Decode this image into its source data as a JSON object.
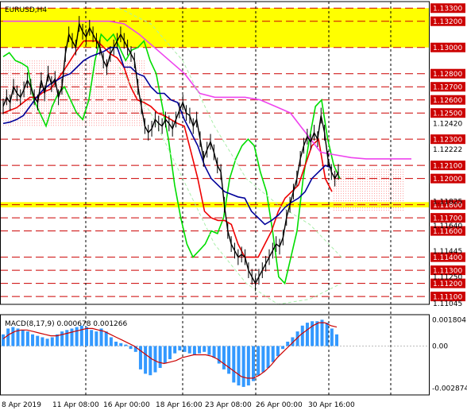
{
  "header": {
    "symbol_label": "EURUSD,H4",
    "macd_label": "MACD(8,17,9) 0.000678 0.001266"
  },
  "colors": {
    "background": "#ffffff",
    "grid": "#000000",
    "level_line": "#cc0000",
    "level_label_bg": "#cc0000",
    "level_label_text": "#ffffff",
    "yellow_zone": "#ffff00",
    "price_series": "#000000",
    "green_line": "#00dd00",
    "red_line": "#ee0000",
    "navy_line": "#000099",
    "magenta_line": "#ee44ee",
    "cloud_dots": "#ff9999",
    "envelope": "#aaeeaa",
    "macd_histogram": "#3399ff",
    "macd_signal": "#cc0000"
  },
  "chart_data": [
    {
      "type": "line",
      "title": "EURUSD,H4",
      "x_tick_labels": [
        "8 Apr 2019",
        "11 Apr 08:00",
        "16 Apr 00:00",
        "18 Apr 16:00",
        "23 Apr 08:00",
        "26 Apr 00:00",
        "30 Apr 16:00"
      ],
      "ylim": [
        1.1104,
        1.1335
      ],
      "grid": true,
      "yellow_zones": [
        [
          1.13,
          1.133
        ],
        [
          1.1178,
          1.1182
        ]
      ],
      "levels": [
        1.133,
        1.132,
        1.13,
        1.128,
        1.127,
        1.126,
        1.125,
        1.123,
        1.121,
        1.12,
        1.118,
        1.117,
        1.116,
        1.114,
        1.113,
        1.112,
        1.111
      ],
      "level_labels": [
        "1.13300",
        "1.13200",
        "1.13000",
        "1.12800",
        "1.12700",
        "1.12600",
        "1.12500",
        "1.12300",
        "1.12100",
        "1.12000",
        "1.11800",
        "1.11700",
        "1.11600",
        "1.11400",
        "1.11300",
        "1.11200",
        "1.11100"
      ],
      "scale_ticks": [
        "1.12420",
        "1.12222",
        "1.11825",
        "1.11640",
        "1.11445",
        "1.11250",
        "1.11045"
      ],
      "price": [
        1.1255,
        1.1262,
        1.1258,
        1.127,
        1.1265,
        1.1262,
        1.1268,
        1.1275,
        1.127,
        1.1262,
        1.1258,
        1.1275,
        1.1265,
        1.128,
        1.1272,
        1.1276,
        1.1262,
        1.127,
        1.1295,
        1.131,
        1.1305,
        1.13,
        1.1318,
        1.1312,
        1.1308,
        1.1315,
        1.131,
        1.1305,
        1.13,
        1.129,
        1.1285,
        1.1295,
        1.13,
        1.1305,
        1.131,
        1.1305,
        1.13,
        1.1295,
        1.129,
        1.127,
        1.1255,
        1.124,
        1.1235,
        1.1238,
        1.1245,
        1.1242,
        1.124,
        1.1245,
        1.1242,
        1.1238,
        1.1245,
        1.1252,
        1.1258,
        1.125,
        1.1248,
        1.124,
        1.1245,
        1.123,
        1.1215,
        1.1222,
        1.1228,
        1.122,
        1.121,
        1.1205,
        1.118,
        1.116,
        1.115,
        1.1145,
        1.114,
        1.1142,
        1.114,
        1.113,
        1.1125,
        1.112,
        1.1125,
        1.113,
        1.1135,
        1.114,
        1.1145,
        1.115,
        1.1148,
        1.1155,
        1.117,
        1.118,
        1.119,
        1.12,
        1.1215,
        1.1225,
        1.1232,
        1.1228,
        1.1235,
        1.123,
        1.1248,
        1.1235,
        1.1215,
        1.1205,
        1.12,
        1.1205
      ],
      "series": [
        {
          "values": [
            1.1293,
            1.1296,
            1.129,
            1.1288,
            1.1285,
            1.126,
            1.125,
            1.124,
            1.1255,
            1.1265,
            1.127,
            1.126,
            1.125,
            1.1245,
            1.126,
            1.129,
            1.131,
            1.1305,
            1.131,
            1.13,
            1.129,
            1.1298,
            1.13,
            1.1305,
            1.129,
            1.128,
            1.1255,
            1.123,
            1.1195,
            1.117,
            1.115,
            1.114,
            1.1145,
            1.115,
            1.116,
            1.1158,
            1.117,
            1.12,
            1.1215,
            1.1225,
            1.123,
            1.1225,
            1.1205,
            1.119,
            1.116,
            1.1125,
            1.112,
            1.114,
            1.116,
            1.12,
            1.123,
            1.1255,
            1.126,
            1.123,
            1.121,
            1.12
          ]
        },
        {
          "values": [
            1.125,
            1.1252,
            1.1254,
            1.1258,
            1.1262,
            1.1262,
            1.1266,
            1.1268,
            1.1275,
            1.1282,
            1.129,
            1.1298,
            1.1305,
            1.1305,
            1.1305,
            1.13,
            1.1295,
            1.1292,
            1.1285,
            1.127,
            1.126,
            1.1258,
            1.1255,
            1.125,
            1.1248,
            1.1245,
            1.1242,
            1.124,
            1.122,
            1.12,
            1.1175,
            1.117,
            1.1168,
            1.1168,
            1.1165,
            1.115,
            1.114,
            1.114,
            1.114,
            1.115,
            1.116,
            1.1175,
            1.1185,
            1.119,
            1.1195,
            1.121,
            1.1225,
            1.123,
            1.12,
            1.119
          ]
        },
        {
          "values": [
            1.1242,
            1.1243,
            1.1245,
            1.1248,
            1.1255,
            1.1262,
            1.1268,
            1.1272,
            1.1275,
            1.1278,
            1.128,
            1.1285,
            1.129,
            1.1293,
            1.1295,
            1.1297,
            1.13,
            1.13,
            1.1285,
            1.1285,
            1.128,
            1.1278,
            1.127,
            1.1265,
            1.1265,
            1.126,
            1.1258,
            1.1245,
            1.1235,
            1.1225,
            1.121,
            1.12,
            1.1195,
            1.119,
            1.1188,
            1.1186,
            1.1185,
            1.1175,
            1.117,
            1.1165,
            1.1168,
            1.1172,
            1.1178,
            1.1182,
            1.1185,
            1.119,
            1.12,
            1.1205,
            1.121,
            1.1208
          ]
        },
        {
          "values": [
            1.132,
            1.132,
            1.132,
            1.132,
            1.132,
            1.132,
            1.132,
            1.132,
            1.1318,
            1.131,
            1.13,
            1.129,
            1.128,
            1.1265,
            1.1262,
            1.1262,
            1.1262,
            1.126,
            1.1255,
            1.125,
            1.1235,
            1.122,
            1.1218,
            1.1216,
            1.1215,
            1.1215,
            1.1215,
            1.1215
          ]
        }
      ]
    },
    {
      "type": "bar",
      "title": "MACD(8,17,9) 0.000678 0.001266",
      "ylim": [
        -0.00335,
        0.00215
      ],
      "scale_ticks": [
        "0.001804",
        "0.00",
        "-0.002874"
      ],
      "values": [
        0.0008,
        0.0012,
        0.0013,
        0.0012,
        0.0011,
        0.001,
        0.0008,
        0.0007,
        0.0006,
        0.0005,
        0.0006,
        0.0008,
        0.001,
        0.0011,
        0.0012,
        0.0013,
        0.0014,
        0.0013,
        0.0011,
        0.001,
        0.0012,
        0.001,
        0.0006,
        0.0003,
        0.0002,
        0.0001,
        -0.0002,
        -0.0004,
        -0.0016,
        -0.0019,
        -0.002,
        -0.0018,
        -0.0015,
        -0.0012,
        -0.0009,
        -0.0005,
        -0.0003,
        -0.0004,
        -0.0005,
        -0.0006,
        -0.0005,
        -0.0004,
        -0.0006,
        -0.0008,
        -0.0012,
        -0.0016,
        -0.0019,
        -0.0025,
        -0.0027,
        -0.0028,
        -0.0027,
        -0.0024,
        -0.002,
        -0.0018,
        -0.0015,
        -0.0011,
        -0.0007,
        -0.0002,
        0.0003,
        0.0006,
        0.001,
        0.0014,
        0.0016,
        0.0017,
        0.0017,
        0.0018,
        0.0016,
        0.0012,
        0.0008
      ],
      "series": [
        {
          "values": [
            0.0005,
            0.0008,
            0.001,
            0.0011,
            0.0011,
            0.001,
            0.0009,
            0.0008,
            0.0007,
            0.0007,
            0.0008,
            0.0009,
            0.001,
            0.0011,
            0.0012,
            0.0012,
            0.0011,
            0.001,
            0.0008,
            0.0006,
            0.0004,
            0.0002,
            0.0,
            -0.0003,
            -0.0006,
            -0.0009,
            -0.0011,
            -0.0012,
            -0.0011,
            -0.001,
            -0.0008,
            -0.0007,
            -0.0006,
            -0.0006,
            -0.0006,
            -0.0007,
            -0.0009,
            -0.0012,
            -0.0015,
            -0.0018,
            -0.0021,
            -0.0022,
            -0.0022,
            -0.002,
            -0.0017,
            -0.0013,
            -0.0008,
            -0.0004,
            0.0,
            0.0004,
            0.0008,
            0.0011,
            0.0014,
            0.0016,
            0.0016,
            0.0014,
            0.0013
          ]
        }
      ]
    }
  ]
}
